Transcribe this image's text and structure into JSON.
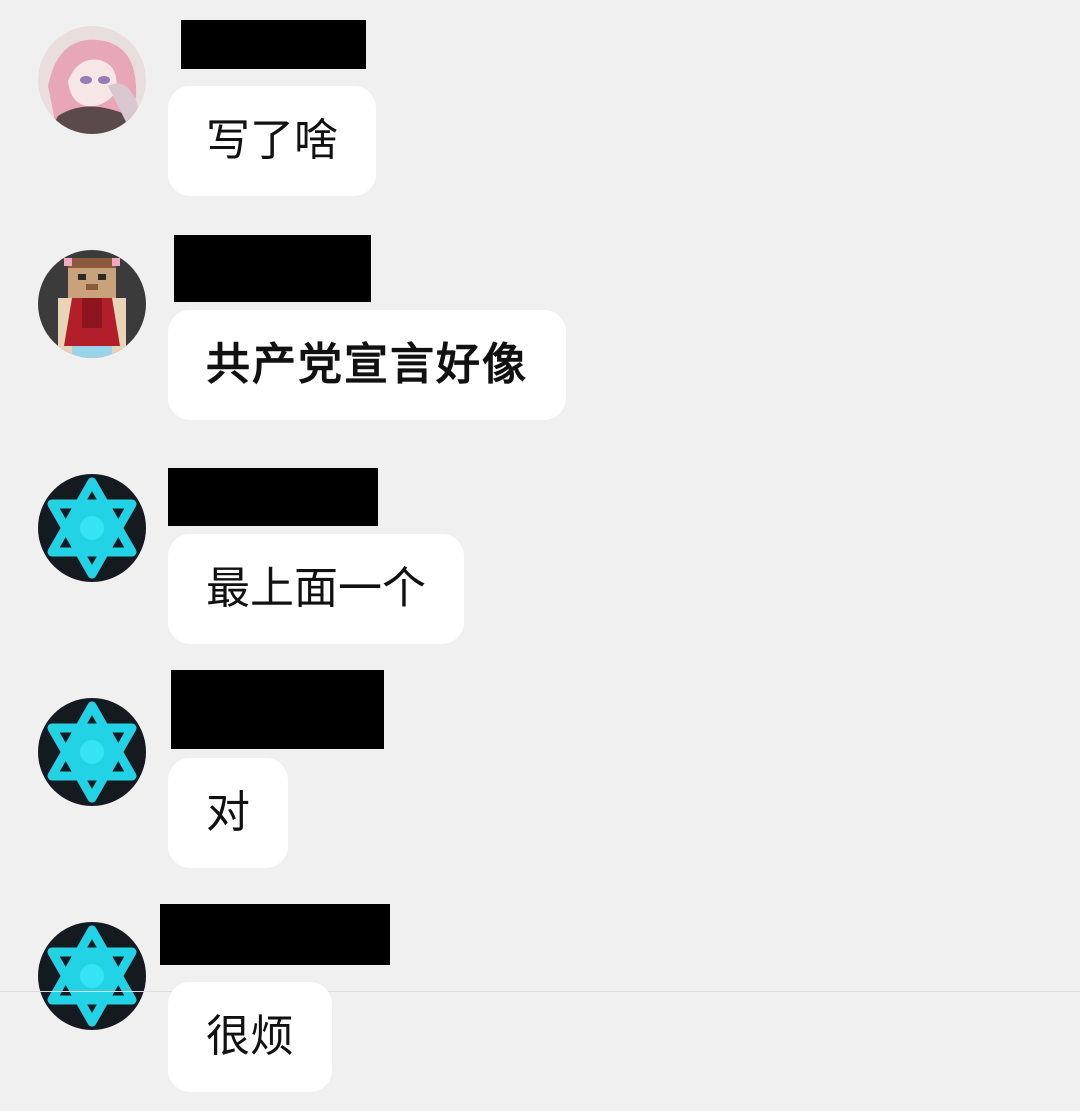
{
  "messages": [
    {
      "avatar": "anime-girl-avatar",
      "name_redacted": true,
      "text": "写了啥"
    },
    {
      "avatar": "pixel-character-avatar",
      "name_redacted": true,
      "text": "共产党宣言好像"
    },
    {
      "avatar": "hexagram-avatar",
      "name_redacted": true,
      "text": "最上面一个"
    },
    {
      "avatar": "hexagram-avatar",
      "name_redacted": true,
      "text": "对"
    },
    {
      "avatar": "hexagram-avatar",
      "name_redacted": true,
      "text": "很烦"
    }
  ],
  "colors": {
    "background": "#f0f0f0",
    "bubble": "#ffffff",
    "text": "#111111",
    "redaction": "#000000",
    "hexagram": "#22d3e6"
  }
}
